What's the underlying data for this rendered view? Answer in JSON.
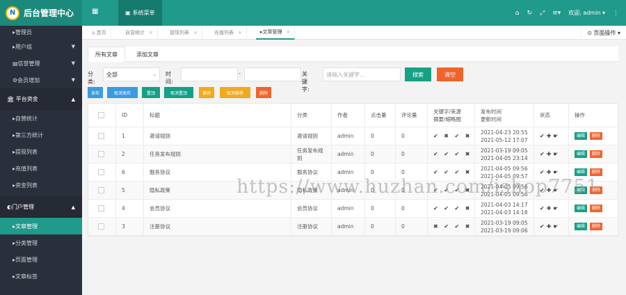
{
  "brand": {
    "title": "后台管理中心",
    "logo_text": "N"
  },
  "top": {
    "menu_toggle": "▦",
    "sys_menu_label": "系统菜单",
    "icons": [
      "home-icon",
      "refresh-icon",
      "fullscreen-icon",
      "menu-icon"
    ],
    "home_glyph": "⌂",
    "refresh_glyph": "↻",
    "fullscreen_glyph": "⤢",
    "menu_glyph": "≡▾",
    "user_label": "欢迎, admin ▾",
    "more_glyph": "⋮"
  },
  "sidebar": {
    "items_top": [
      {
        "label": "▸管理员"
      },
      {
        "label": "▸用户组",
        "caret": "▼"
      },
      {
        "label": "▤信誉管理",
        "caret": "▼"
      },
      {
        "label": "⚙会员增加",
        "caret": "▼"
      }
    ],
    "section1": {
      "label": "🏛 平台资金",
      "caret": "▲"
    },
    "section1_items": [
      {
        "label": "▸自营统计"
      },
      {
        "label": "▸第三方统计"
      },
      {
        "label": "▸提现列表"
      },
      {
        "label": "▸充值列表"
      },
      {
        "label": "▸资金列表"
      }
    ],
    "section2": {
      "label": "◐门户管理",
      "caret": "▲"
    },
    "section2_items": [
      {
        "label": "▸文章管理",
        "active": true
      },
      {
        "label": "▸分类管理"
      },
      {
        "label": "▸页面管理"
      },
      {
        "label": "▸文章标签"
      }
    ]
  },
  "tabs": [
    {
      "label": "⌂ 首页",
      "close": ""
    },
    {
      "label": "自营统计",
      "close": "×"
    },
    {
      "label": "提现列表",
      "close": "×"
    },
    {
      "label": "充值列表",
      "close": "×"
    },
    {
      "label": "▸文章管理",
      "close": "×",
      "active": true
    }
  ],
  "page_ops": "⊙ 页面操作 ▾",
  "subtabs": [
    "所有文章",
    "添加文章"
  ],
  "filter": {
    "category_label": "分类:",
    "category_value": "全部",
    "time_label": "时间:",
    "dash": "-",
    "keyword_label": "关键字:",
    "keyword_placeholder": "请输入关键字...",
    "search_button": "搜索",
    "clear_button": "清空"
  },
  "actions": [
    {
      "label": "发布",
      "color": "#3a9be0"
    },
    {
      "label": "取消发布",
      "color": "#3a9be0"
    },
    {
      "label": "置顶",
      "color": "#16a085"
    },
    {
      "label": "取消置顶",
      "color": "#16a085"
    },
    {
      "label": "推荐",
      "color": "#f2a91f"
    },
    {
      "label": "取消推荐",
      "color": "#f2a91f"
    },
    {
      "label": "删除",
      "color": "#f0642b"
    }
  ],
  "table": {
    "headers": [
      "ID",
      "标题",
      "分类",
      "作者",
      "点击量",
      "评论量",
      "关键字/来源",
      "摘要/缩略图",
      "发布时间",
      "更新时间",
      "状态",
      "操作"
    ],
    "rows": [
      {
        "id": "1",
        "title": "邀请规则",
        "category": "邀请规则",
        "author": "admin",
        "hits": "0",
        "comments": "0",
        "flags": "✔ ✖ ✔ ✖",
        "published": "2021-04-23 20:55",
        "updated": "2021-05-12 17:07",
        "status": "✔✚☛"
      },
      {
        "id": "2",
        "title": "任务发布规则",
        "category": "任务发布规",
        "category2": "则",
        "author": "admin",
        "hits": "0",
        "comments": "0",
        "flags": "✔ ✔ ✔ ✖",
        "published": "2021-03-19 09:05",
        "updated": "2021-04-05 23:14",
        "status": "✔✚☛"
      },
      {
        "id": "6",
        "title": "服务协议",
        "category": "服务协议",
        "author": "admin",
        "hits": "0",
        "comments": "0",
        "flags": "✔ ✔ ✔ ✖",
        "published": "2021-04-05 09:56",
        "updated": "2021-04-05 09:57",
        "status": "✔✚☛"
      },
      {
        "id": "5",
        "title": "隐私政策",
        "category": "隐私政策",
        "author": "admin",
        "hits": "0",
        "comments": "0",
        "flags": "✔ ✔ ✔ ✖",
        "published": "2021-04-05 09:56",
        "updated": "2021-04-05 09:56",
        "status": "✔✚☛"
      },
      {
        "id": "4",
        "title": "会员协议",
        "category": "会员协议",
        "author": "admin",
        "hits": "0",
        "comments": "0",
        "flags": "✔ ✔ ✔ ✖",
        "published": "2021-04-03 14:17",
        "updated": "2021-04-03 14:18",
        "status": "✔✚☛"
      },
      {
        "id": "3",
        "title": "注册协议",
        "category": "注册协议",
        "author": "admin",
        "hits": "0",
        "comments": "0",
        "flags": "✖ ✔ ✔ ✖",
        "published": "2021-03-19 09:05",
        "updated": "2021-03-19 09:06",
        "status": "✔✚☛"
      }
    ],
    "edit_label": "编辑",
    "delete_label": "删除"
  },
  "watermark": "https://www.huzhan.com/ishop7751"
}
